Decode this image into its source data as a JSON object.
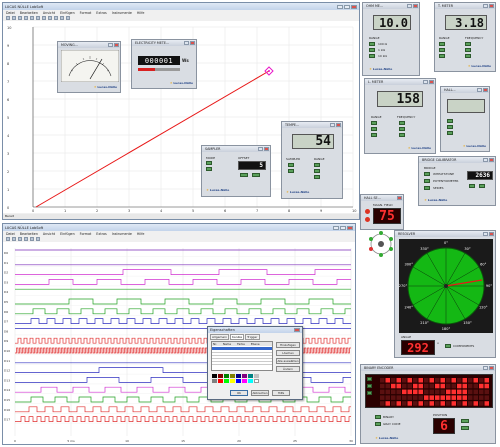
{
  "colors": {
    "plot_line": "#e81818",
    "marker": "#e818c8",
    "dial_green": "#14b814",
    "led_red": "#ff3030",
    "accent": "#2a4a8a"
  },
  "main_window": {
    "title": "LUCAS NÜLLE LabSoft",
    "menu": [
      "Datei",
      "Bearbeiten",
      "Ansicht",
      "Einfügen",
      "Format",
      "Extras",
      "Instrumente",
      "Hilfe"
    ],
    "y_ticks": [
      "10",
      "9",
      "8",
      "7",
      "6",
      "5",
      "4",
      "3",
      "2",
      "1",
      "0"
    ],
    "x_ticks": [
      "0",
      "1",
      "2",
      "3",
      "4",
      "5",
      "6",
      "7",
      "8",
      "9",
      "10"
    ],
    "status": "Bereit"
  },
  "instruments": {
    "moving_coil": {
      "title": "MOVING..."
    },
    "electricity_meter": {
      "title": "ELECTRICITY METE...",
      "counter": "000001",
      "unit": "Ws"
    },
    "sampler": {
      "title": "SAMPLER",
      "mode_label": "MODE",
      "offset_label": "OFFSET",
      "offset_value": "5"
    },
    "temperature": {
      "title": "TEMPE...",
      "value": "54",
      "sampler_label": "SAMPLER",
      "range_label": "RANGE"
    },
    "ohm_meter": {
      "title": "OHM ME...",
      "value": "10.0",
      "range_label": "RANGE",
      "ranges": [
        "100 Ω",
        "1 kΩ",
        "10 kΩ"
      ]
    },
    "t_meter": {
      "title": "T. METER",
      "value": "3.18",
      "range_label": "RANGE",
      "frequency_label": "FREQUENCY"
    },
    "l_meter": {
      "title": "L. METER",
      "value": "158",
      "range_label": "RANGE",
      "frequency_label": "FREQUENCY"
    },
    "hall": {
      "title": "HALL..."
    },
    "bridge_calibrator": {
      "title": "BRIDGE CALIBRATOR",
      "bridge_label": "BRIDGE",
      "value": "2636",
      "options": [
        "WHEATSTONE",
        "POTENTIOMETER",
        "SERIES"
      ]
    },
    "hall_sensor": {
      "title": "HALL SE...",
      "value": "75",
      "label": "MAGN. FIELD"
    },
    "resolver": {
      "title": "RESOLVER",
      "angle_label": "ANGLE",
      "value": "292",
      "unit": "°",
      "components_label": "COMPONENTS",
      "dial_labels": [
        "0°",
        "30°",
        "60°",
        "90°",
        "120°",
        "150°",
        "180°",
        "210°",
        "240°",
        "270°",
        "300°",
        "330°"
      ]
    },
    "binary_encoder": {
      "title": "BINARY ENCODER",
      "binary_label": "BINARY",
      "gray_code_label": "GRAY CODE",
      "position_label": "POSITION",
      "value": "6"
    }
  },
  "logic_window": {
    "title": "LUCAS NÜLLE LabSoft",
    "menu": [
      "Datei",
      "Bearbeiten",
      "Ansicht",
      "Einfügen",
      "Format",
      "Extras",
      "Instrumente",
      "Hilfe"
    ],
    "channels": [
      "D0",
      "D1",
      "D2",
      "D3",
      "D4",
      "D5",
      "D6",
      "D7",
      "D8",
      "D9",
      "D10",
      "D11",
      "D12",
      "D13",
      "D14",
      "D15",
      "D16",
      "D17"
    ],
    "x_ticks": [
      "0",
      "5 ms",
      "10",
      "15",
      "20",
      "25",
      "30"
    ],
    "dialog": {
      "title": "Eigenschaften",
      "tabs": [
        "Allgemein",
        "Kanäle",
        "Trigger"
      ],
      "columns": [
        "Nr.",
        "Name",
        "Farbe",
        "Ebene"
      ],
      "buttons": [
        "Hinzufügen",
        "Löschen",
        "Alle auswählen",
        "Ändern"
      ],
      "ok": "OK",
      "cancel": "Abbrechen",
      "help": "Hilfe"
    }
  }
}
